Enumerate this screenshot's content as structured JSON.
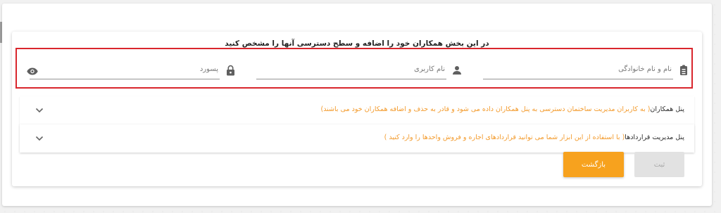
{
  "form": {
    "title": "در این بخش همکاران خود را اضافه و سطح دسترسی آنها را مشخص کنید",
    "fields": [
      {
        "label": "نام و نام خانوادگی",
        "icon": "badge-icon"
      },
      {
        "label": "نام کاربری",
        "icon": "person-icon"
      },
      {
        "label": "پسورد",
        "icon": "lock-icon",
        "trailing_icon": "eye-icon"
      }
    ]
  },
  "panels": [
    {
      "title": "پنل همکاران",
      "description": "( به کاربران مدیریت ساختمان دسترسی به پنل همکاران داده می شود و قادر به حذف و اضافه همکاران خود می باشند)"
    },
    {
      "title": "پنل مدیریت قراردادها",
      "description": "( با استفاده از این ابزار شما می توانید قراردادهای اجاره و فروش واحدها را وارد کنید )"
    }
  ],
  "buttons": {
    "back_label": "بازگشت",
    "submit_label": "ثبت"
  },
  "colors": {
    "accent": "#f7a21e",
    "highlight_border": "#d9262d",
    "description_text": "#f39a2b",
    "disabled_button": "#e2e2e2"
  }
}
